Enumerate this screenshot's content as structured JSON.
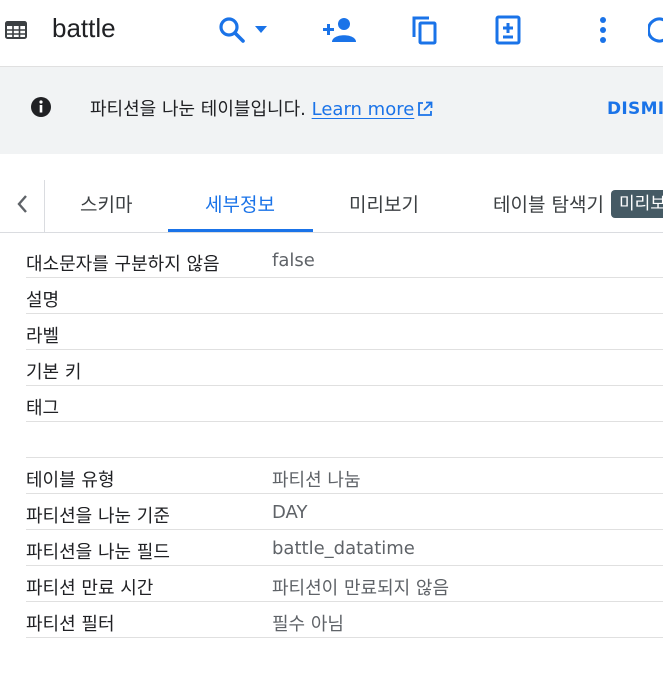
{
  "header": {
    "title": "battle",
    "icons": [
      "table-icon",
      "search-icon",
      "dropdown-arrow-icon",
      "add-person-icon",
      "copy-icon",
      "add-document-icon",
      "more-vert-icon"
    ]
  },
  "banner": {
    "text": "파티션을 나눈 테이블입니다.",
    "link": "Learn more",
    "dismiss": "DISMISS",
    "icons": [
      "info-icon",
      "external-link-icon"
    ]
  },
  "tabs": {
    "items": [
      {
        "label": "스키마"
      },
      {
        "label": "세부정보"
      },
      {
        "label": "미리보기"
      },
      {
        "label": "테이블 탐색기"
      }
    ],
    "active": "세부정보",
    "badge": "미리보기"
  },
  "details_group1": [
    {
      "key": "대소문자를 구분하지 않음",
      "value": "false"
    },
    {
      "key": "설명",
      "value": ""
    },
    {
      "key": "라벨",
      "value": ""
    },
    {
      "key": "기본 키",
      "value": ""
    },
    {
      "key": "태그",
      "value": ""
    }
  ],
  "details_group2": [
    {
      "key": "테이블 유형",
      "value": "파티션 나눔"
    },
    {
      "key": "파티션을 나눈 기준",
      "value": "DAY"
    },
    {
      "key": "파티션을 나눈 필드",
      "value": "battle_datatime"
    },
    {
      "key": "파티션 만료 시간",
      "value": "파티션이 만료되지 않음"
    },
    {
      "key": "파티션 필터",
      "value": "필수 아님"
    }
  ],
  "colors": {
    "accent": "#1a73e8",
    "banner_bg": "#f1f3f4",
    "badge_bg": "#455a64",
    "text_primary": "#202124",
    "text_secondary": "#5f6368"
  }
}
